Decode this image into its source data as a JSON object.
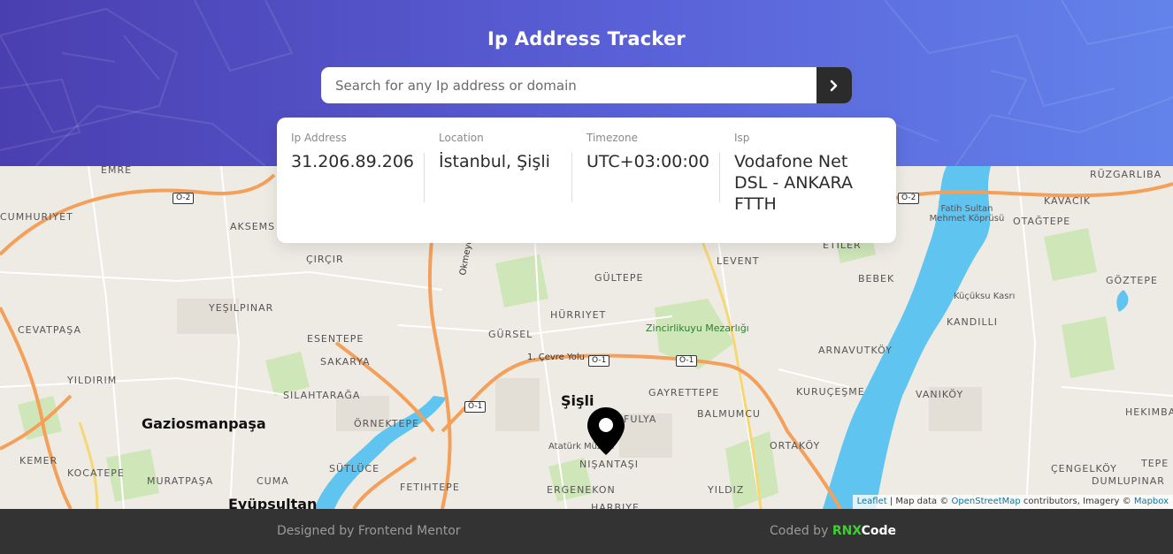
{
  "header": {
    "title": "Ip Address Tracker",
    "search_placeholder": "Search for any Ip address or domain",
    "search_button_icon": "chevron-right-icon"
  },
  "info": {
    "ip_label": "Ip Address",
    "ip_value": "31.206.89.206",
    "location_label": "Location",
    "location_value": "İstanbul, Şişli",
    "timezone_label": "Timezone",
    "timezone_value": "UTC+03:00:00",
    "isp_label": "Isp",
    "isp_value": "Vodafone Net DSL - ANKARA FTTH"
  },
  "map": {
    "place_labels": [
      "EMRE",
      "CUMHURIYET",
      "AKSEMS",
      "ÇIRÇIR",
      "YEŞILPINAR",
      "CEVATPAŞA",
      "ESENTEPE",
      "SAKARYA",
      "YILDIRIM",
      "SILAHTARAĞA",
      "ÖRNEKTEPE",
      "KEMER",
      "KOCATEPE",
      "MURATPAŞA",
      "SÜTLÜCE",
      "CUMA",
      "FETIHTEPE",
      "ERGENEKON",
      "NIŞANTAŞI",
      "HARBIYE",
      "FULYA",
      "BALMUMCU",
      "YILDIZ",
      "GAYRETTEPE",
      "ORTAKÖY",
      "GÜLTEPE",
      "HÜRRIYET",
      "GÜRSEL",
      "LEVENT",
      "ETILER",
      "BEBEK",
      "ARNAVUTKÖY",
      "KURUÇEŞME",
      "VANIKÖY",
      "KANDILLI",
      "GÖZTEPE",
      "KAVACIK",
      "OTAĞTEPE",
      "RÜZGARLIBA",
      "HEKIMBA",
      "ÇENGELKÖY",
      "DUMLUPINAR",
      "TEPE"
    ],
    "district_labels": [
      "Gaziosmanpaşa",
      "Eyüpsultan",
      "Şişli"
    ],
    "poi_labels": [
      "Zincirlikuyu Mezarlığı",
      "Fatih Sultan Mehmet Köprüsü",
      "Küçüksu Kasrı",
      "Atatürk Müzesi"
    ],
    "road_labels": [
      "1. Çevre Yolu",
      "Okmeydanı"
    ],
    "road_shields": [
      "O-2",
      "O-2",
      "O-1",
      "O-1",
      "O-1"
    ],
    "marker_icon": "location-pin-icon",
    "attribution": {
      "leaflet": "Leaflet",
      "data": " | Map data © ",
      "osm": "OpenStreetMap",
      "contrib": " contributors, Imagery © ",
      "mapbox": "Mapbox"
    }
  },
  "footer": {
    "designed_by": "Designed by Frontend Mentor",
    "coded_by_prefix": "Coded by ",
    "coded_by_rnx": "RNX",
    "coded_by_code": "Code"
  },
  "colors": {
    "header_gradient_start": "#4a3fb0",
    "header_gradient_end": "#6383ea",
    "button_dark": "#2b2b2b",
    "water": "#5fc4f0",
    "highway": "#f5a05a",
    "footer_bg": "#333333",
    "accent_green": "#3dd130"
  }
}
